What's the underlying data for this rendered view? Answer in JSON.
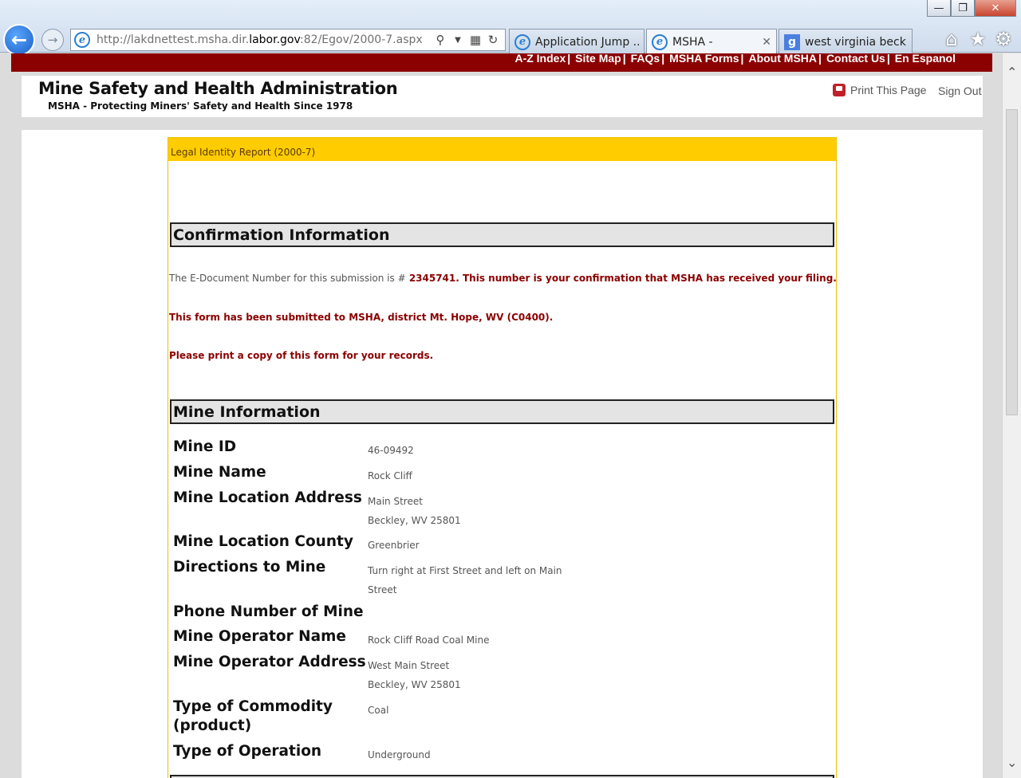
{
  "browser": {
    "url_prefix": "http://lakdnettest.msha.dir.",
    "url_domain": "labor.gov",
    "url_suffix": ":82/Egov/2000-7.aspx",
    "tabs": [
      {
        "label": "Application Jump ..."
      },
      {
        "label": "MSHA -"
      },
      {
        "label": "west virginia beckl..."
      }
    ]
  },
  "top_nav": {
    "links": [
      "A-Z Index",
      "Site Map",
      "FAQs",
      "MSHA Forms",
      "About MSHA",
      "Contact Us",
      "En Espanol"
    ],
    "separator": "|"
  },
  "header": {
    "title": "Mine Safety and Health Administration",
    "tagline": "MSHA - Protecting Miners' Safety and Health Since 1978",
    "print_label": "Print This Page",
    "sign_out_label": "Sign Out"
  },
  "form": {
    "title": "Legal Identity Report (2000-7)",
    "confirmation": {
      "heading": "Confirmation Information",
      "doc_number_prefix": "The E-Document Number for this submission is #",
      "doc_number_text": "2345741. This number is your confirmation that MSHA has received your filing.",
      "submitted_text": "This form has been submitted to MSHA, district Mt. Hope, WV (C0400).",
      "print_text": "Please print a copy of this form for your records."
    },
    "mine_info": {
      "heading": "Mine Information",
      "fields": [
        {
          "label": "Mine ID",
          "value": [
            "46-09492"
          ]
        },
        {
          "label": "Mine Name",
          "value": [
            "Rock Cliff"
          ]
        },
        {
          "label": "Mine Location Address",
          "value": [
            "Main Street",
            "Beckley, WV 25801"
          ]
        },
        {
          "label": "Mine Location County",
          "value": [
            "Greenbrier"
          ]
        },
        {
          "label": "Directions to Mine",
          "value": [
            "Turn right at First Street and left on Main",
            "Street"
          ]
        },
        {
          "label": "Phone Number of Mine",
          "value": [
            ""
          ]
        },
        {
          "label": "Mine Operator Name",
          "value": [
            "Rock Cliff Road Coal Mine"
          ]
        },
        {
          "label": "Mine Operator Address",
          "value": [
            "West Main Street",
            "Beckley, WV 25801"
          ]
        },
        {
          "label": "Type of Commodity (product)",
          "value": [
            "Coal"
          ]
        },
        {
          "label": "Type of Operation",
          "value": [
            "Underground"
          ]
        }
      ]
    }
  }
}
